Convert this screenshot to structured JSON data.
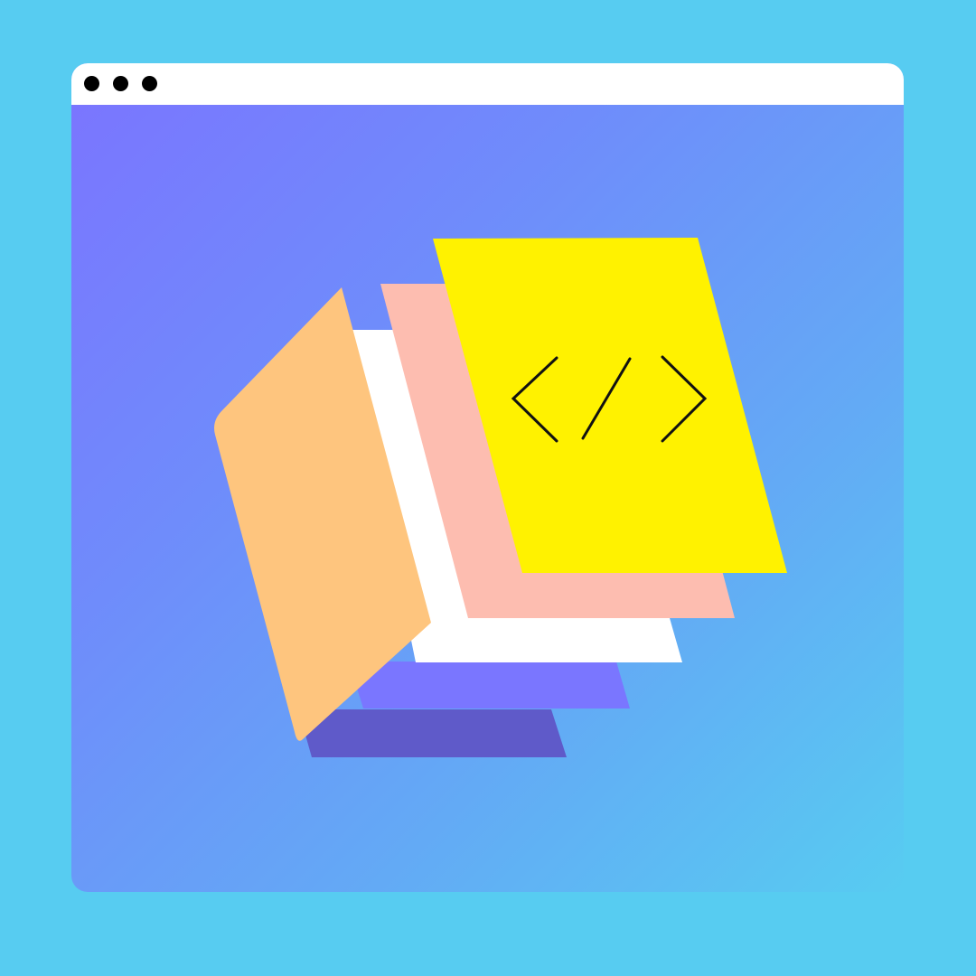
{
  "colors": {
    "page_background": "#57CCF1",
    "window_chrome": "#FFFFFF",
    "gradient_start": "#7B74FF",
    "gradient_end": "#57CCF1",
    "page_dark_purple": "#5F5AC9",
    "page_purple": "#7A76FF",
    "page_white": "#FFFFFF",
    "page_peach": "#FDBDB0",
    "page_yellow": "#FFF200",
    "page_orange_cover": "#FEC57E",
    "code_symbol_stroke": "#111111"
  },
  "window_controls": [
    {
      "name": "close"
    },
    {
      "name": "minimize"
    },
    {
      "name": "maximize"
    }
  ],
  "illustration": {
    "subject": "stacked-document-pages",
    "icon": "code-tag-icon"
  }
}
